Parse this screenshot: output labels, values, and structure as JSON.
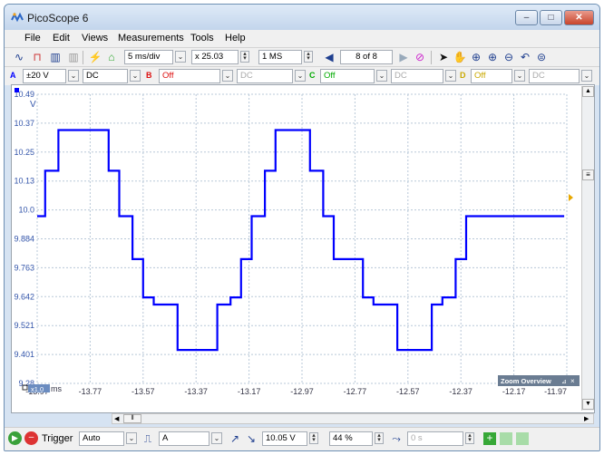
{
  "window": {
    "title": "PicoScope 6",
    "minimize_glyph": "–",
    "maximize_glyph": "□",
    "close_glyph": "✕",
    "app_icon": "picoscope-logo-icon"
  },
  "menu": [
    "File",
    "Edit",
    "Views",
    "Measurements",
    "Tools",
    "Help"
  ],
  "toolbar": {
    "timebase": "5 ms/div",
    "zoom_factor": "x 25.03",
    "samples": "1 MS",
    "buffer_position": "8 of 8"
  },
  "channel_toolbar": {
    "a_label": "A",
    "a_range": "±20 V",
    "a_coupling": "DC",
    "b_label": "B",
    "b_state": "Off",
    "b_coupling": "DC",
    "c_label": "C",
    "c_state": "Off",
    "c_coupling": "DC",
    "d_label": "D",
    "d_state": "Off",
    "d_coupling": "DC"
  },
  "scope": {
    "y_unit": "V",
    "y_ticks": [
      "10.49",
      "10.37",
      "10.25",
      "10.13",
      "10.0",
      "9.884",
      "9.763",
      "9.642",
      "9.521",
      "9.401",
      "9.28"
    ],
    "x_ticks": [
      "-13.97",
      "-13.77",
      "-13.57",
      "-13.37",
      "-13.17",
      "-12.97",
      "-12.77",
      "-12.57",
      "-12.37",
      "-12.17",
      "-11.97"
    ],
    "x_unit": "ms",
    "x_scale_badge": "x1.0",
    "zoom_overview_label": "Zoom Overview",
    "trace_color": "#0000ff",
    "grid_color": "#b8c8d8"
  },
  "chart_data": {
    "type": "line",
    "series": [
      {
        "x": [
          -13.97,
          -13.94,
          -13.94,
          -13.89,
          -13.89,
          -13.85,
          -13.85,
          -13.7,
          -13.7,
          -13.66,
          -13.66,
          -13.61,
          -13.61,
          -13.57,
          -13.57,
          -13.53,
          -13.53,
          -13.48,
          -13.48,
          -13.44,
          -13.44,
          -13.4,
          -13.4,
          -13.29,
          -13.29,
          -13.24,
          -13.24,
          -13.2,
          -13.2,
          -13.16,
          -13.16,
          -13.11,
          -13.11,
          -13.07,
          -13.07,
          -13.02,
          -13.02,
          -12.98,
          -12.98,
          -12.94,
          -12.94,
          -12.89,
          -12.89,
          -12.85,
          -12.85,
          -12.74,
          -12.74,
          -12.7,
          -12.7,
          -12.65,
          -12.65,
          -12.61,
          -12.61,
          -12.57,
          -12.57,
          -12.52,
          -12.52,
          -12.48,
          -12.48,
          -12.44,
          -12.44,
          -12.39,
          -12.39,
          -12.35,
          -12.35,
          -12.24,
          -12.24,
          -12.2,
          -12.2,
          -12.15,
          -12.15,
          -12.11,
          -12.11,
          -12.07,
          -12.07,
          -12.02,
          -12.02,
          -11.98
        ],
        "y": [
          9.98,
          9.98,
          10.17,
          10.17,
          10.34,
          10.34,
          10.34,
          10.34,
          10.17,
          10.17,
          9.98,
          9.98,
          9.8,
          9.8,
          9.64,
          9.64,
          9.61,
          9.61,
          9.61,
          9.61,
          9.42,
          9.42,
          9.42,
          9.42,
          9.61,
          9.61,
          9.64,
          9.64,
          9.8,
          9.8,
          9.98,
          9.98,
          10.17,
          10.17,
          10.34,
          10.34,
          10.34,
          10.34,
          10.34,
          10.34,
          10.17,
          10.17,
          9.98,
          9.98,
          9.8,
          9.8,
          9.64,
          9.64,
          9.61,
          9.61,
          9.61,
          9.61,
          9.42,
          9.42,
          9.42,
          9.42,
          9.42,
          9.42,
          9.61,
          9.61,
          9.64,
          9.64,
          9.8,
          9.8,
          9.98,
          9.98,
          9.98,
          9.98,
          9.98,
          9.98,
          9.98,
          9.98,
          9.98,
          9.98,
          9.98,
          9.98,
          9.98,
          9.98
        ]
      }
    ],
    "xlabel": "ms",
    "ylabel": "V",
    "xlim": [
      -13.97,
      -11.97
    ],
    "ylim": [
      9.28,
      10.49
    ],
    "grid": true
  },
  "statusbar": {
    "trigger_label": "Trigger",
    "trigger_mode": "Auto",
    "trigger_source": "A",
    "trigger_level": "10.05 V",
    "pre_trigger": "44 %",
    "delay": "0 s"
  }
}
